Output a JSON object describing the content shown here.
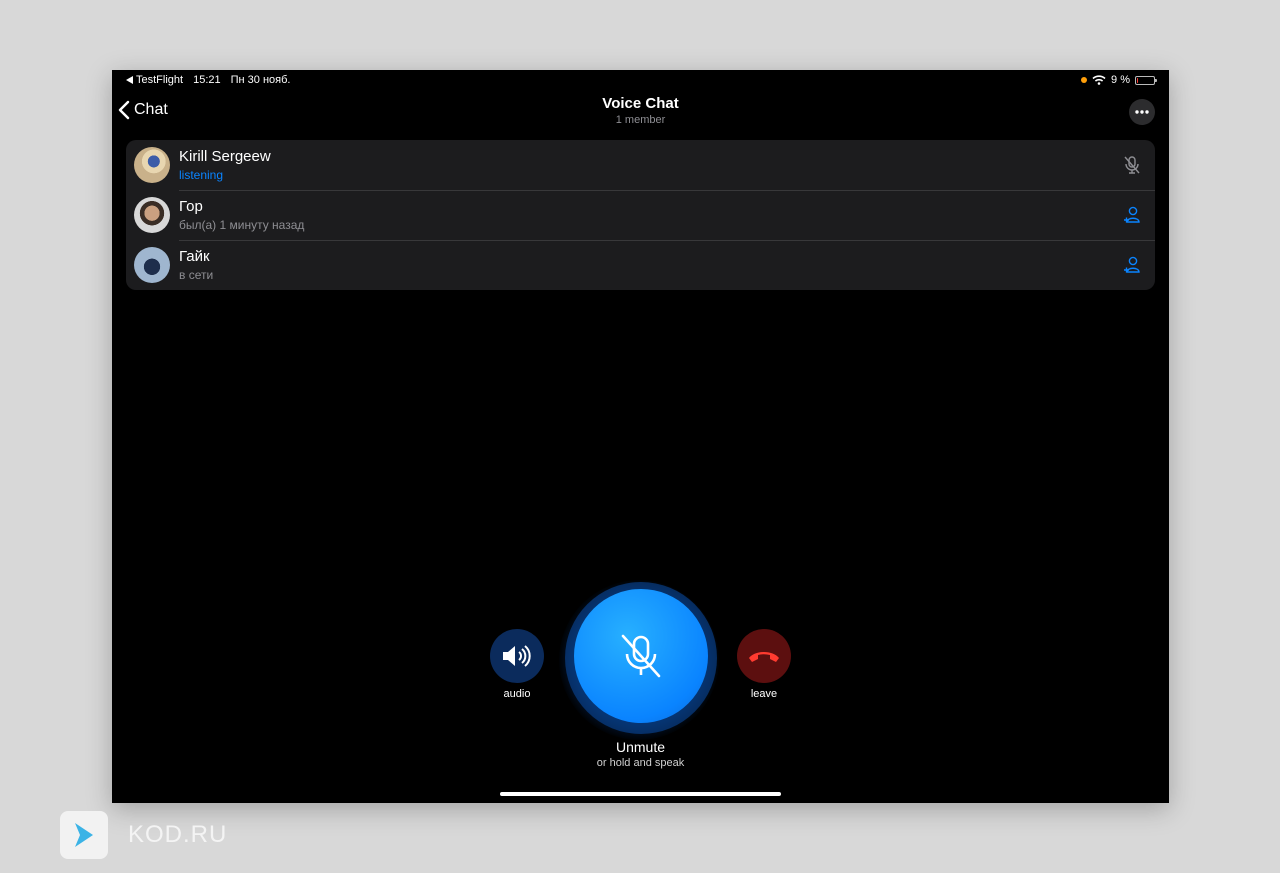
{
  "status_bar": {
    "back_app": "TestFlight",
    "time": "15:21",
    "date": "Пн 30 нояб.",
    "battery_text": "9 %",
    "battery_level": 0.09
  },
  "nav": {
    "back_label": "Chat",
    "title": "Voice Chat",
    "subtitle": "1 member",
    "more_icon": "ellipsis-icon"
  },
  "participants": [
    {
      "name": "Kirill Sergeew",
      "status": "listening",
      "status_color": "#0a84ff",
      "action_icon": "mic-off-icon"
    },
    {
      "name": "Гор",
      "status": "был(а) 1 минуту назад",
      "status_color": "#8e8e93",
      "action_icon": "add-user-icon"
    },
    {
      "name": "Гайк",
      "status": "в сети",
      "status_color": "#8e8e93",
      "action_icon": "add-user-icon"
    }
  ],
  "controls": {
    "audio_label": "audio",
    "leave_label": "leave",
    "main_label": "Unmute",
    "main_hint": "or hold and speak"
  },
  "colors": {
    "accent": "#0a84ff",
    "leave": "#ff3b30",
    "background": "#000000",
    "list_background": "#1c1c1e"
  },
  "watermark": {
    "text": "KOD.RU"
  }
}
